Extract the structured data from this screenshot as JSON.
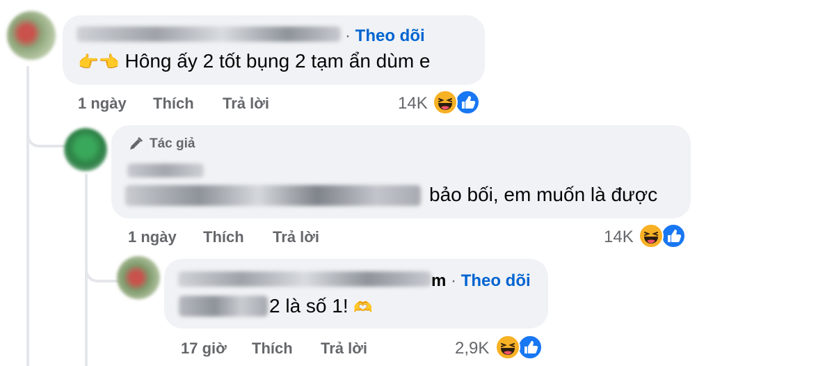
{
  "comments": [
    {
      "follow_label": "Theo dõi",
      "emoji_prefix": "👉👈",
      "text": "Hông ấy 2 tốt bụng 2 tạm ẩn dùm e",
      "actions": {
        "time": "1 ngày",
        "like": "Thích",
        "reply": "Trả lời"
      },
      "reaction_count": "14K"
    },
    {
      "author_badge": "Tác giả",
      "text": "bảo bối, em muốn là được",
      "actions": {
        "time": "1 ngày",
        "like": "Thích",
        "reply": "Trả lời"
      },
      "reaction_count": "14K"
    },
    {
      "name_tail": "m",
      "separator": "·",
      "follow_label": "Theo dõi",
      "text": "2 là số 1!",
      "emoji_suffix": "🫶",
      "actions": {
        "time": "17 giờ",
        "like": "Thích",
        "reply": "Trả lời"
      },
      "reaction_count": "2,9K"
    }
  ],
  "colors": {
    "bubble": "#f0f2f5",
    "link": "#0064d1",
    "meta": "#65676b",
    "like_blue": "#1877f2",
    "haha_yellow": "#f7b125"
  },
  "icons": [
    "haha-icon",
    "like-icon",
    "pen-icon"
  ]
}
